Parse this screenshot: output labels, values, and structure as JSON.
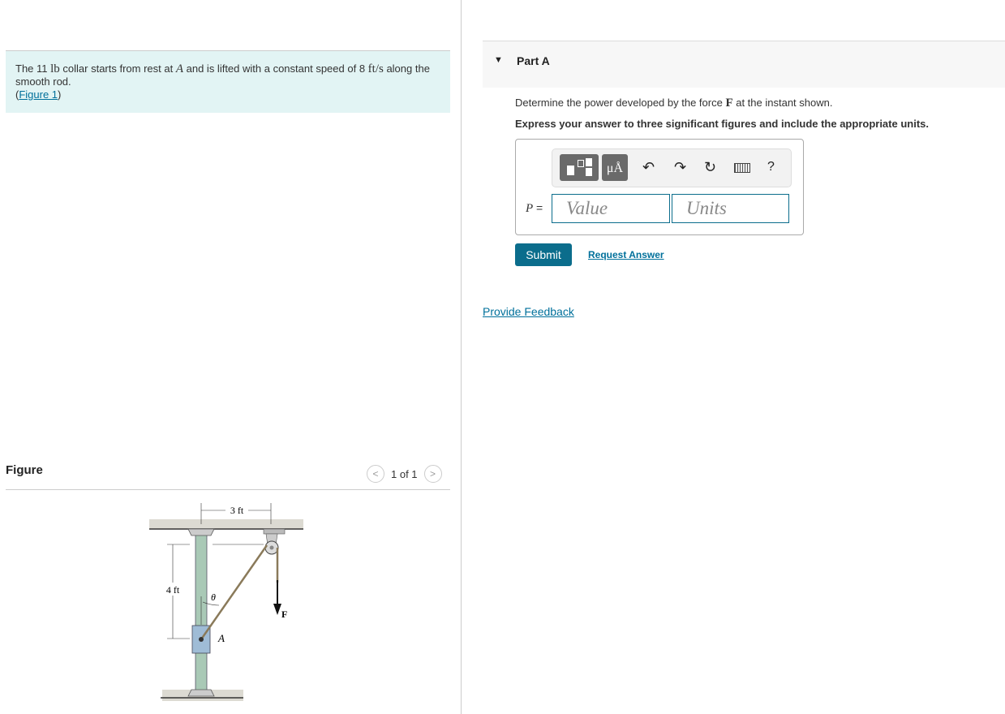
{
  "problem": {
    "pre": "The 11 ",
    "mass_unit": "lb",
    "mid": " collar starts from rest at ",
    "point": "A",
    "mid2": " and is lifted with a constant speed of 8 ",
    "speed_unit": "ft/s",
    "post": " along the smooth rod.",
    "figure_link": "Figure 1"
  },
  "figure": {
    "heading": "Figure",
    "pager": "1 of 1",
    "labels": {
      "width": "3 ft",
      "height": "4 ft",
      "theta": "θ",
      "point": "A",
      "force": "F"
    }
  },
  "part": {
    "title": "Part A",
    "question_pre": "Determine the power developed by the force ",
    "question_var": "F",
    "question_post": " at the instant shown.",
    "instruction": "Express your answer to three significant figures and include the appropriate units.",
    "toolbar": {
      "units_btn": "μÅ",
      "undo": "↶",
      "redo": "↷",
      "reset": "↻",
      "help": "?"
    },
    "answer_label": "P =",
    "value_placeholder": "Value",
    "units_placeholder": "Units",
    "submit": "Submit",
    "request": "Request Answer"
  },
  "feedback": "Provide Feedback",
  "colors": {
    "accent": "#0b6d8c",
    "problem_bg": "#e2f4f4"
  }
}
